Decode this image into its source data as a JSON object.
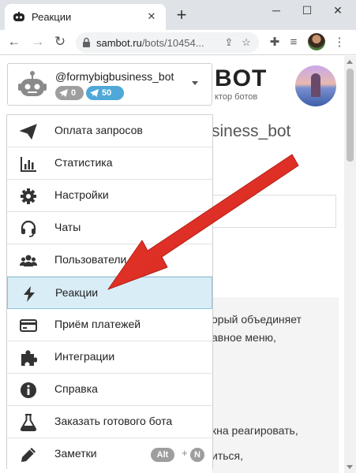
{
  "browser": {
    "tab_title": "Реакции",
    "tab_close": "✕",
    "new_tab": "+",
    "url_host": "sambot.ru",
    "url_path": "/bots/10454...",
    "window": {
      "minimize": "─",
      "maximize": "☐",
      "close": "✕"
    }
  },
  "page": {
    "logo_text": "BOT",
    "logo_subtitle": "ктор ботов",
    "bot_heading": "siness_bot",
    "text_lines": [
      "орый объединяет",
      "авное меню,",
      "кна реагировать,",
      "иться,"
    ]
  },
  "account": {
    "bot_name": "@formybigbusiness_bot",
    "badge_grey": "0",
    "badge_blue": "50"
  },
  "menu": {
    "items": [
      {
        "label": "Оплата запросов",
        "icon": "paper-plane-icon"
      },
      {
        "label": "Статистика",
        "icon": "bar-chart-icon"
      },
      {
        "label": "Настройки",
        "icon": "gear-icon"
      },
      {
        "label": "Чаты",
        "icon": "headset-icon"
      },
      {
        "label": "Пользователи",
        "icon": "users-icon"
      },
      {
        "label": "Реакции",
        "icon": "lightning-icon",
        "active": true
      },
      {
        "label": "Приём платежей",
        "icon": "credit-card-icon"
      },
      {
        "label": "Интеграции",
        "icon": "puzzle-icon"
      },
      {
        "label": "Справка",
        "icon": "info-icon"
      },
      {
        "label": "Заказать готового бота",
        "icon": "flask-icon"
      },
      {
        "label": "Заметки",
        "icon": "pencil-icon"
      }
    ],
    "shortcut_alt": "Alt",
    "shortcut_plus": "+",
    "shortcut_key": "N"
  },
  "colors": {
    "active_bg": "#d9edf7",
    "badge_blue": "#4ea8d8",
    "badge_grey": "#9e9e9e",
    "arrow": "#e8352b"
  }
}
